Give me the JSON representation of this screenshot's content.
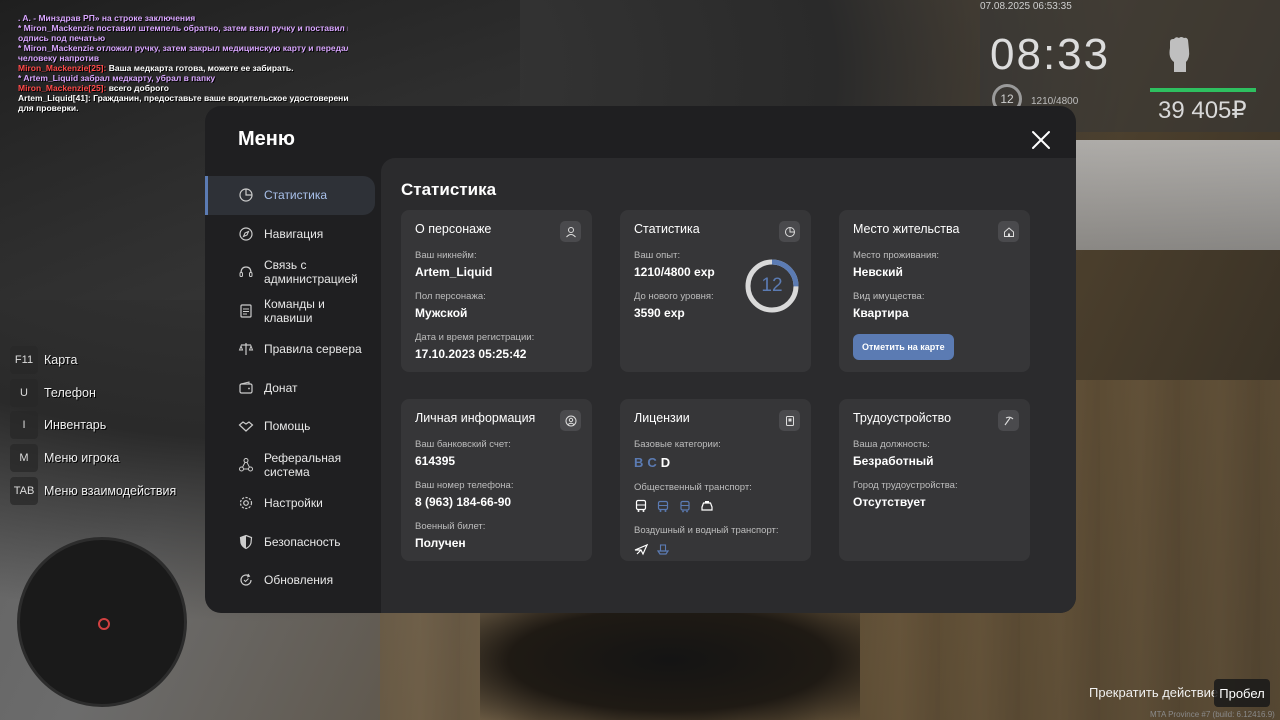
{
  "chat": [
    {
      "text": ". A. - Минздрав РП» на строке заключения",
      "color": "purple"
    },
    {
      "text": " * Miron_Mackenzie поставил штемпель обратно, затем взял ручку и поставил п",
      "color": "purple"
    },
    {
      "text": "одпись под печатью",
      "color": "purple"
    },
    {
      "text": " * Miron_Mackenzie отложил ручку, затем закрыл медицинскую карту и передал",
      "color": "purple"
    },
    {
      "text": " человеку напротив",
      "color": "purple"
    },
    {
      "speaker": "Miron_Mackenzie[25]:",
      "text": " Ваша медкарта готова, можете ее забирать.",
      "color": "red"
    },
    {
      "text": " * Artem_Liquid забрал медкарту, убрал в папку",
      "color": "purple"
    },
    {
      "speaker": "Miron_Mackenzie[25]:",
      "text": " всего доброго",
      "color": "red"
    },
    {
      "text": "Artem_Liquid[41]: Гражданин, предоставьте ваше водительское удостоверение",
      "color": "white"
    },
    {
      "text": " для проверки.",
      "color": "white"
    }
  ],
  "hud": {
    "date": "07.08.2025 06:53:35",
    "time": "08:33",
    "level": "12",
    "exp": "1210/4800",
    "money": "39 405₽"
  },
  "hotkeys": [
    {
      "key": "F11",
      "label": "Карта"
    },
    {
      "key": "U",
      "label": "Телефон"
    },
    {
      "key": "I",
      "label": "Инвентарь"
    },
    {
      "key": "M",
      "label": "Меню игрока"
    },
    {
      "key": "TAB",
      "label": "Меню взаимодействия"
    }
  ],
  "bottom": {
    "action": "Прекратить действие",
    "key": "Пробел",
    "watermark": "MTA Province #7 (build: 6.12416.9)"
  },
  "menu": {
    "title": "Меню",
    "sidebar": [
      {
        "label": "Статистика",
        "icon": "pie-chart-icon",
        "active": true
      },
      {
        "label": "Навигация",
        "icon": "compass-icon"
      },
      {
        "label": "Связь с администрацией",
        "icon": "headset-icon"
      },
      {
        "label": "Команды и клавиши",
        "icon": "document-icon"
      },
      {
        "label": "Правила сервера",
        "icon": "scales-icon"
      },
      {
        "label": "Донат",
        "icon": "wallet-icon"
      },
      {
        "label": "Помощь",
        "icon": "handshake-icon"
      },
      {
        "label": "Реферальная система",
        "icon": "network-icon"
      },
      {
        "label": "Настройки",
        "icon": "gear-icon"
      },
      {
        "label": "Безопасность",
        "icon": "shield-icon"
      },
      {
        "label": "Обновления",
        "icon": "refresh-icon"
      }
    ],
    "content_title": "Статистика",
    "cards": {
      "character": {
        "title": "О персонаже",
        "nick_label": "Ваш никнейм:",
        "nick": "Artem_Liquid",
        "gender_label": "Пол персонажа:",
        "gender": "Мужской",
        "reg_label": "Дата и время регистрации:",
        "reg": "17.10.2023 05:25:42"
      },
      "stats": {
        "title": "Статистика",
        "exp_label": "Ваш опыт:",
        "exp": "1210/4800 exp",
        "next_label": "До нового уровня:",
        "next": "3590 exp",
        "level": "12",
        "progress": 0.252
      },
      "residence": {
        "title": "Место жительства",
        "place_label": "Место проживания:",
        "place": "Невский",
        "property_label": "Вид имущества:",
        "property": "Квартира",
        "button": "Отметить на карте"
      },
      "personal": {
        "title": "Личная информация",
        "bank_label": "Ваш банковский счет:",
        "bank": "614395",
        "phone_label": "Ваш номер телефона:",
        "phone": "8 (963) 184-66-90",
        "military_label": "Военный билет:",
        "military": "Получен"
      },
      "licenses": {
        "title": "Лицензии",
        "base_label": "Базовые категории:",
        "categories": [
          {
            "letter": "B",
            "owned": true
          },
          {
            "letter": "C",
            "owned": true
          },
          {
            "letter": "D",
            "owned": false
          }
        ],
        "public_label": "Общественный транспорт:",
        "air_label": "Воздушный и водный транспорт:"
      },
      "employment": {
        "title": "Трудоустройство",
        "position_label": "Ваша должность:",
        "position": "Безработный",
        "city_label": "Город трудоустройства:",
        "city": "Отсутствует"
      }
    },
    "colors": {
      "accent": "#5b7bb3",
      "panel": "#1f1f21",
      "card": "#363638"
    }
  }
}
